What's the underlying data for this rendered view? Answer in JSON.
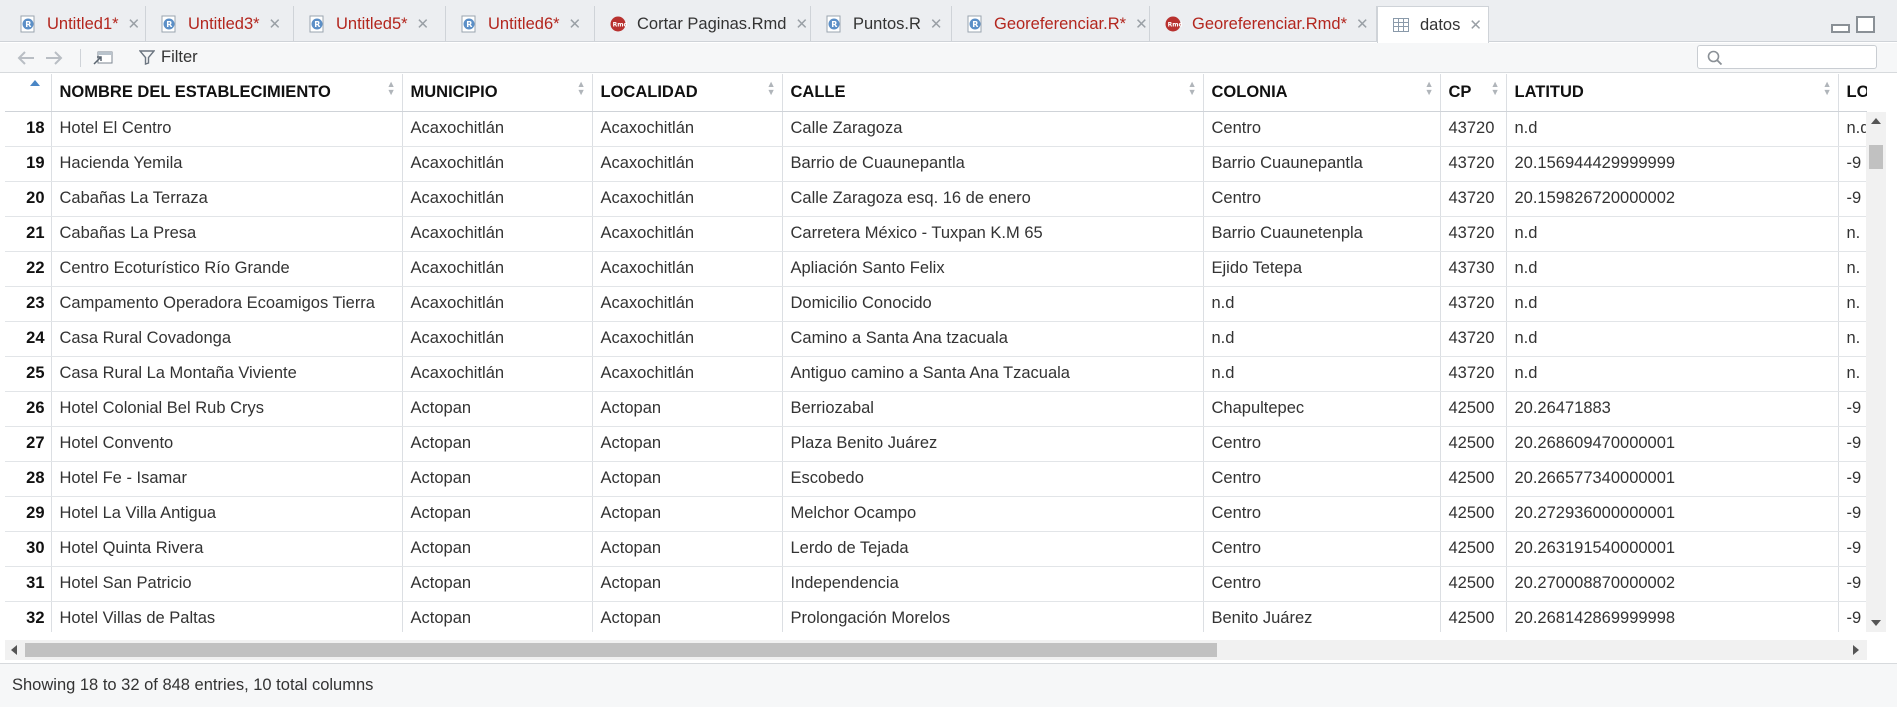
{
  "tabs": [
    {
      "label": "Untitled1*",
      "dirty": true,
      "icon": "r-script-icon"
    },
    {
      "label": "Untitled3*",
      "dirty": true,
      "icon": "r-script-icon"
    },
    {
      "label": "Untitled5*",
      "dirty": true,
      "icon": "r-script-icon"
    },
    {
      "label": "Untitled6*",
      "dirty": true,
      "icon": "r-script-icon"
    },
    {
      "label": "Cortar Paginas.Rmd",
      "dirty": false,
      "icon": "rmd-icon"
    },
    {
      "label": "Puntos.R",
      "dirty": false,
      "icon": "r-script-icon"
    },
    {
      "label": "Georeferenciar.R*",
      "dirty": true,
      "icon": "r-script-icon"
    },
    {
      "label": "Georeferenciar.Rmd*",
      "dirty": true,
      "icon": "rmd-icon"
    },
    {
      "label": "datos",
      "dirty": false,
      "icon": "table-icon",
      "active": true
    }
  ],
  "toolbar": {
    "filter_label": "Filter",
    "search_placeholder": ""
  },
  "table": {
    "columns": [
      "NOMBRE DEL ESTABLECIMIENTO",
      "MUNICIPIO",
      "LOCALIDAD",
      "CALLE",
      "COLONIA",
      "CP",
      "LATITUD",
      "LONG"
    ],
    "rows": [
      {
        "n": "18",
        "cells": [
          "Hotel El Centro",
          "Acaxochitlán",
          "Acaxochitlán",
          "Calle Zaragoza",
          "Centro",
          "43720",
          "n.d",
          "n.d"
        ]
      },
      {
        "n": "19",
        "cells": [
          "Hacienda Yemila",
          "Acaxochitlán",
          "Acaxochitlán",
          "Barrio de Cuaunepantla",
          "Barrio Cuaunepantla",
          "43720",
          "20.156944429999999",
          "-9"
        ]
      },
      {
        "n": "20",
        "cells": [
          "Cabañas La Terraza",
          "Acaxochitlán",
          "Acaxochitlán",
          "Calle Zaragoza esq. 16 de enero",
          "Centro",
          "43720",
          "20.159826720000002",
          "-9"
        ]
      },
      {
        "n": "21",
        "cells": [
          "Cabañas La Presa",
          "Acaxochitlán",
          "Acaxochitlán",
          "Carretera México - Tuxpan K.M 65",
          "Barrio Cuaunetenpla",
          "43720",
          "n.d",
          "n."
        ]
      },
      {
        "n": "22",
        "cells": [
          "Centro Ecoturístico Río Grande",
          "Acaxochitlán",
          "Acaxochitlán",
          "Apliación Santo Felix",
          "Ejido Tetepa",
          "43730",
          "n.d",
          "n."
        ]
      },
      {
        "n": "23",
        "cells": [
          "Campamento Operadora Ecoamigos Tierra",
          "Acaxochitlán",
          "Acaxochitlán",
          "Domicilio Conocido",
          "n.d",
          "43720",
          "n.d",
          "n."
        ]
      },
      {
        "n": "24",
        "cells": [
          "Casa Rural Covadonga",
          "Acaxochitlán",
          "Acaxochitlán",
          "Camino a Santa Ana tzacuala",
          "n.d",
          "43720",
          "n.d",
          "n."
        ]
      },
      {
        "n": "25",
        "cells": [
          "Casa Rural La Montaña Viviente",
          "Acaxochitlán",
          "Acaxochitlán",
          "Antiguo camino a Santa Ana Tzacuala",
          "n.d",
          "43720",
          "n.d",
          "n."
        ]
      },
      {
        "n": "26",
        "cells": [
          "Hotel Colonial Bel Rub Crys",
          "Actopan",
          "Actopan",
          "Berriozabal",
          "Chapultepec",
          "42500",
          "20.26471883",
          "-9"
        ]
      },
      {
        "n": "27",
        "cells": [
          "Hotel Convento",
          "Actopan",
          "Actopan",
          "Plaza Benito Juárez",
          "Centro",
          "42500",
          "20.268609470000001",
          "-9"
        ]
      },
      {
        "n": "28",
        "cells": [
          "Hotel Fe - Isamar",
          "Actopan",
          "Actopan",
          "Escobedo",
          "Centro",
          "42500",
          "20.266577340000001",
          "-9"
        ]
      },
      {
        "n": "29",
        "cells": [
          "Hotel La Villa Antigua",
          "Actopan",
          "Actopan",
          "Melchor Ocampo",
          "Centro",
          "42500",
          "20.272936000000001",
          "-9"
        ]
      },
      {
        "n": "30",
        "cells": [
          "Hotel Quinta Rivera",
          "Actopan",
          "Actopan",
          "Lerdo de Tejada",
          "Centro",
          "42500",
          "20.263191540000001",
          "-9"
        ]
      },
      {
        "n": "31",
        "cells": [
          "Hotel San Patricio",
          "Actopan",
          "Actopan",
          "Independencia",
          "Centro",
          "42500",
          "20.270008870000002",
          "-9"
        ]
      },
      {
        "n": "32",
        "cells": [
          "Hotel Villas de Paltas",
          "Actopan",
          "Actopan",
          "Prolongación Morelos",
          "Benito Juárez",
          "42500",
          "20.268142869999998",
          "-9"
        ]
      },
      {
        "n": "",
        "cells": [
          "",
          "",
          "",
          "",
          "",
          "",
          "",
          ""
        ]
      }
    ]
  },
  "status": {
    "text": "Showing 18 to 32 of 848 entries, 10 total columns"
  },
  "colors": {
    "dirty_tab_text": "#b3261e",
    "sort_indicator": "#4a86c5"
  }
}
